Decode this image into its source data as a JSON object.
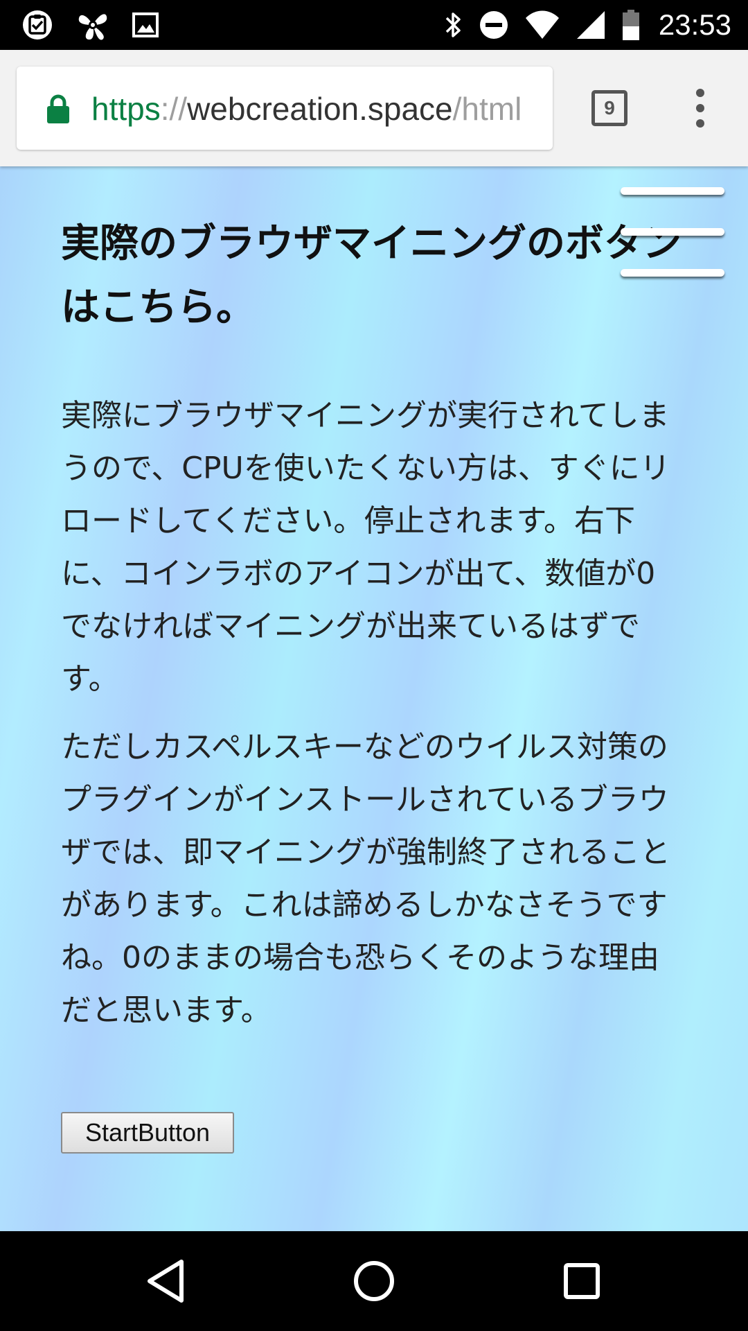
{
  "status_bar": {
    "time": "23:53",
    "left_icons": [
      "task-check-icon",
      "pinwheel-app-icon",
      "image-icon"
    ],
    "right_icons": [
      "bluetooth-icon",
      "do-not-disturb-icon",
      "wifi-icon",
      "cell-signal-icon",
      "battery-icon"
    ]
  },
  "browser": {
    "url_scheme": "https",
    "url_separator": "://",
    "url_host": "webcreation.space",
    "url_path": "/html",
    "tab_count": "9",
    "secure_color": "#0b8043"
  },
  "page": {
    "title": "実際のブラウザマイニングのボタンはこちら。",
    "paragraph1": "実際にブラウザマイニングが実行されてしまうので、CPUを使いたくない方は、すぐにリロードしてください。停止されます。右下に、コインラボのアイコンが出て、数値が0でなければマイニングが出来ているはずです。",
    "paragraph2": "ただしカスペルスキーなどのウイルス対策のプラグインがインストールされているブラウザでは、即マイニングが強制終了されることがあります。これは諦めるしかなさそうですね。0のままの場合も恐らくそのような理由だと思います。",
    "start_button_label": "StartButton",
    "menu_icon": "hamburger-menu-icon"
  },
  "nav_bar": {
    "icons": [
      "back-icon",
      "home-icon",
      "recents-icon"
    ]
  }
}
